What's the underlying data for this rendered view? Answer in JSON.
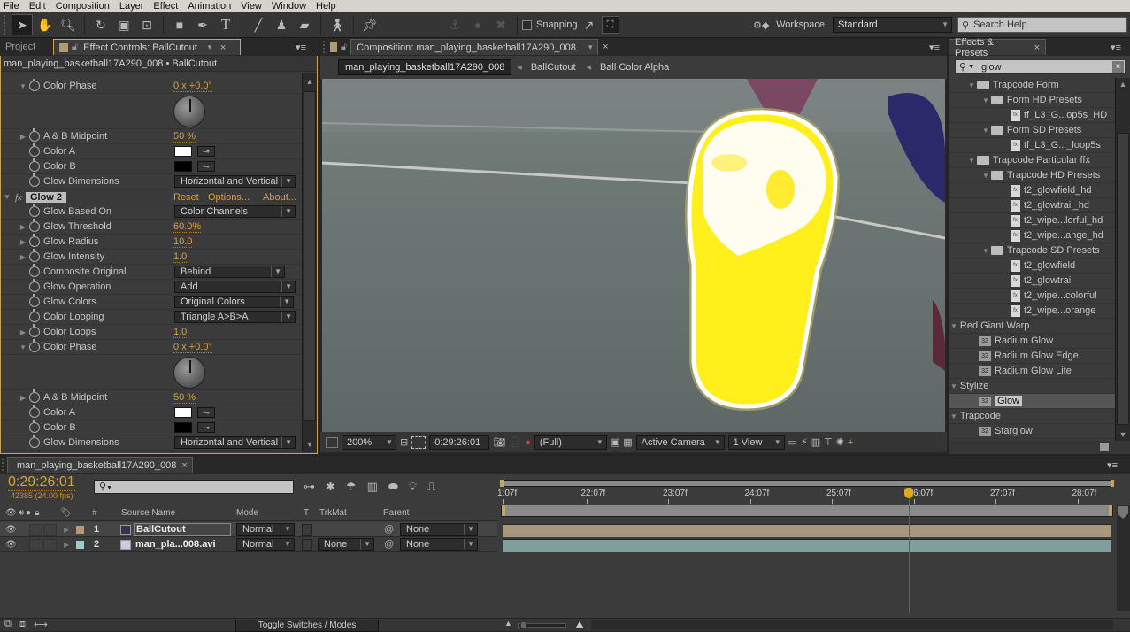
{
  "menu": [
    "File",
    "Edit",
    "Composition",
    "Layer",
    "Effect",
    "Animation",
    "View",
    "Window",
    "Help"
  ],
  "toolbar": {
    "tools": [
      "selection-tool",
      "hand-tool",
      "zoom-tool",
      "rotation-tool",
      "camera-tool",
      "pan-behind-tool",
      "rectangle-tool",
      "pen-tool",
      "type-tool",
      "brush-tool",
      "clone-stamp-tool",
      "eraser-tool",
      "roto-brush-tool",
      "puppet-pin-tool"
    ],
    "snapping_label": "Snapping",
    "workspace_label": "Workspace:",
    "workspace_value": "Standard",
    "search_help_placeholder": "Search Help"
  },
  "left_panel": {
    "tab_project": "Project",
    "tab_effect_controls": "Effect Controls: BallCutout",
    "breadcrumb": "man_playing_basketball17A290_008 • BallCutout",
    "rows_top": [
      {
        "type": "value",
        "label": "Color Phase",
        "value": "0 x +0.0°",
        "twirl": "open"
      },
      {
        "type": "value",
        "label": "A & B Midpoint",
        "value": "50 %",
        "twirl": "closed"
      },
      {
        "type": "color",
        "label": "Color A",
        "color": "#ffffff"
      },
      {
        "type": "color",
        "label": "Color B",
        "color": "#000000"
      },
      {
        "type": "dropdown",
        "label": "Glow Dimensions",
        "value": "Horizontal and Vertical"
      }
    ],
    "effect": {
      "name": "Glow 2",
      "reset": "Reset",
      "options": "Options...",
      "about": "About..."
    },
    "rows_effect": [
      {
        "type": "dropdown",
        "label": "Glow Based On",
        "value": "Color Channels"
      },
      {
        "type": "value",
        "label": "Glow Threshold",
        "value": "60.0%"
      },
      {
        "type": "value",
        "label": "Glow Radius",
        "value": "10.0"
      },
      {
        "type": "value",
        "label": "Glow Intensity",
        "value": "1.0"
      },
      {
        "type": "dropdown",
        "label": "Composite Original",
        "value": "Behind"
      },
      {
        "type": "dropdown",
        "label": "Glow Operation",
        "value": "Add"
      },
      {
        "type": "dropdown",
        "label": "Glow Colors",
        "value": "Original Colors"
      },
      {
        "type": "dropdown",
        "label": "Color Looping",
        "value": "Triangle A>B>A"
      },
      {
        "type": "value",
        "label": "Color Loops",
        "value": "1.0"
      },
      {
        "type": "value",
        "label": "Color Phase",
        "value": "0 x +0.0°"
      },
      {
        "type": "value",
        "label": "A & B Midpoint",
        "value": "50 %"
      },
      {
        "type": "color",
        "label": "Color A",
        "color": "#ffffff"
      },
      {
        "type": "color",
        "label": "Color B",
        "color": "#000000"
      },
      {
        "type": "dropdown",
        "label": "Glow Dimensions",
        "value": "Horizontal and Vertical"
      }
    ]
  },
  "composition": {
    "tab": "Composition: man_playing_basketball17A290_008",
    "crumbs": [
      "man_playing_basketball17A290_008",
      "BallCutout",
      "Ball Color Alpha"
    ],
    "zoom": "200%",
    "timecode": "0:29:26:01",
    "resolution": "(Full)",
    "camera": "Active Camera",
    "views": "1 View"
  },
  "effects_presets": {
    "tab": "Effects & Presets",
    "search": "glow",
    "items": [
      {
        "kind": "folder",
        "depth": 1,
        "label": "Trapcode Form"
      },
      {
        "kind": "folder",
        "depth": 2,
        "label": "Form HD Presets"
      },
      {
        "kind": "preset",
        "depth": 3,
        "label": "tf_L3_G...op5s_HD"
      },
      {
        "kind": "folder",
        "depth": 2,
        "label": "Form SD Presets"
      },
      {
        "kind": "preset",
        "depth": 3,
        "label": "tf_L3_G..._loop5s"
      },
      {
        "kind": "folder",
        "depth": 1,
        "label": "Trapcode Particular ffx"
      },
      {
        "kind": "folder",
        "depth": 2,
        "label": "Trapcode HD Presets"
      },
      {
        "kind": "preset",
        "depth": 3,
        "label": "t2_glowfield_hd"
      },
      {
        "kind": "preset",
        "depth": 3,
        "label": "t2_glowtrail_hd"
      },
      {
        "kind": "preset",
        "depth": 3,
        "label": "t2_wipe...lorful_hd"
      },
      {
        "kind": "preset",
        "depth": 3,
        "label": "t2_wipe...ange_hd"
      },
      {
        "kind": "folder",
        "depth": 2,
        "label": "Trapcode SD Presets"
      },
      {
        "kind": "preset",
        "depth": 3,
        "label": "t2_glowfield"
      },
      {
        "kind": "preset",
        "depth": 3,
        "label": "t2_glowtrail"
      },
      {
        "kind": "preset",
        "depth": 3,
        "label": "t2_wipe...colorful"
      },
      {
        "kind": "preset",
        "depth": 3,
        "label": "t2_wipe...orange"
      },
      {
        "kind": "category",
        "depth": 0,
        "label": "Red Giant Warp"
      },
      {
        "kind": "effect",
        "depth": 1,
        "label": "Radium Glow"
      },
      {
        "kind": "effect",
        "depth": 1,
        "label": "Radium Glow Edge"
      },
      {
        "kind": "effect",
        "depth": 1,
        "label": "Radium Glow Lite"
      },
      {
        "kind": "category",
        "depth": 0,
        "label": "Stylize"
      },
      {
        "kind": "effect",
        "depth": 1,
        "label": "Glow",
        "selected": true
      },
      {
        "kind": "category",
        "depth": 0,
        "label": "Trapcode"
      },
      {
        "kind": "effect",
        "depth": 1,
        "label": "Starglow"
      }
    ]
  },
  "timeline": {
    "tab": "man_playing_basketball17A290_008",
    "timecode": "0:29:26:01",
    "frame_info": "42385 (24.00 fps)",
    "columns": {
      "num": "#",
      "source": "Source Name",
      "mode": "Mode",
      "t": "T",
      "trkmat": "TrkMat",
      "parent": "Parent"
    },
    "layers": [
      {
        "num": "1",
        "name": "BallCutout",
        "mode": "Normal",
        "trkmat": "",
        "parent": "None",
        "label_color": "#b09a78",
        "bar_color": "#a8977f",
        "selected": true
      },
      {
        "num": "2",
        "name": "man_pla...008.avi",
        "mode": "Normal",
        "trkmat": "None",
        "parent": "None",
        "label_color": "#9ecaca",
        "bar_color": "#7f9e9c"
      }
    ],
    "ruler": [
      "1:07f",
      "22:07f",
      "23:07f",
      "24:07f",
      "25:07f",
      "26:07f",
      "27:07f",
      "28:07f"
    ],
    "playhead_position": 0.987,
    "toggle_label": "Toggle Switches / Modes"
  },
  "colors": {
    "accent": "#d4a23a",
    "playhead": "#d03030",
    "panel_border": "#c9a35a"
  }
}
